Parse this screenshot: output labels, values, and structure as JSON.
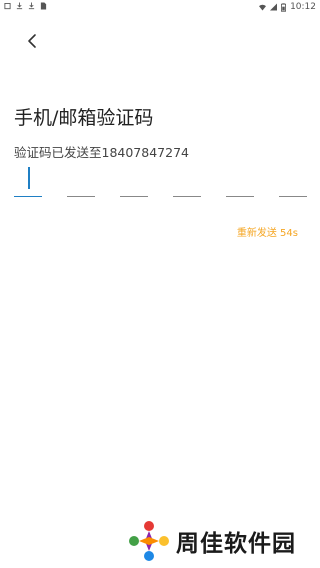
{
  "status_bar": {
    "time": "10:12",
    "icons": [
      "app-notification-icon",
      "download-icon",
      "download-icon",
      "sim-icon",
      "wifi-icon",
      "signal-icon",
      "battery-icon"
    ]
  },
  "header": {
    "back_icon": "chevron-left-icon"
  },
  "page": {
    "title": "手机/邮箱验证码",
    "subtitle": "验证码已发送至18407847274"
  },
  "code_input": {
    "length": 6,
    "digits": [
      "",
      "",
      "",
      "",
      "",
      ""
    ]
  },
  "resend": {
    "label": "重新发送 54s",
    "color": "#f5a623"
  },
  "watermark": {
    "text": "周佳软件园"
  },
  "colors": {
    "accent": "#1f7fc4",
    "timer": "#f5a623"
  }
}
